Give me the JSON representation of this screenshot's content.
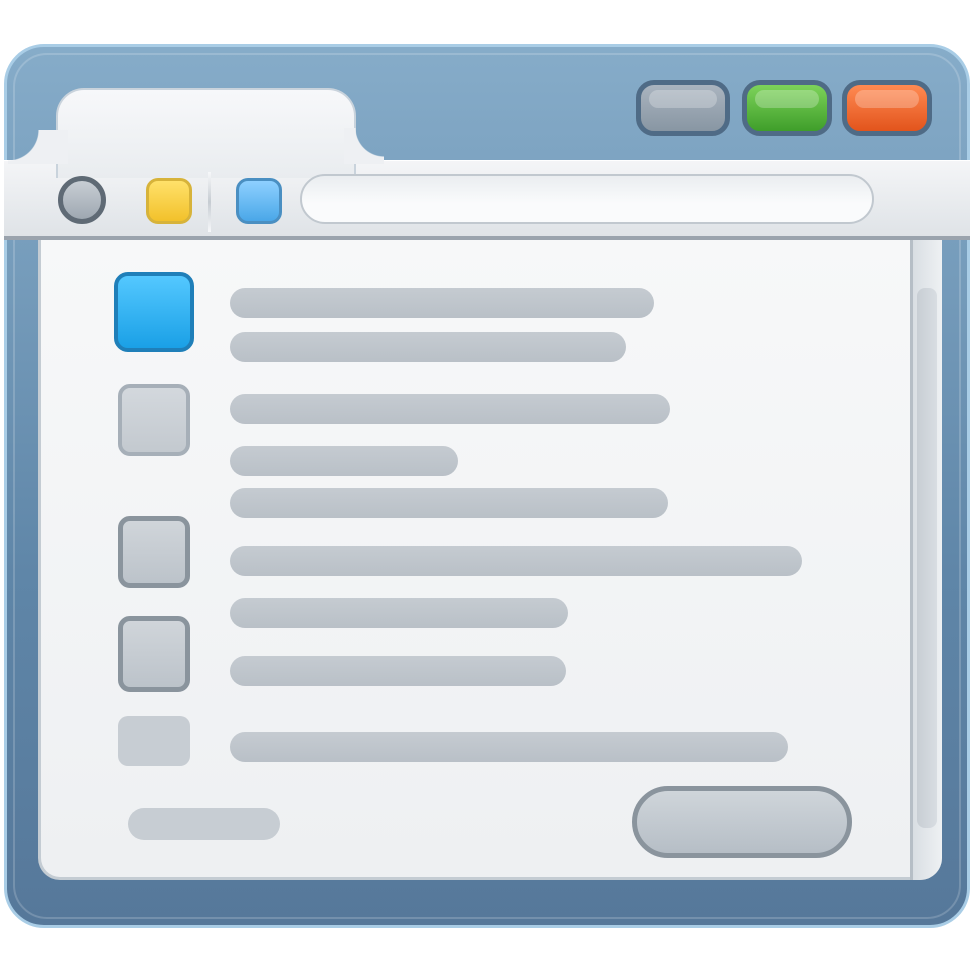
{
  "window": {
    "accent_color": "#5f86a8",
    "controls": [
      {
        "name": "minimize",
        "icon": "minimize-icon",
        "color": "#9aa5b0"
      },
      {
        "name": "maximize",
        "icon": "maximize-icon",
        "color": "#4fb83a"
      },
      {
        "name": "close",
        "icon": "close-icon",
        "color": "#f06526"
      }
    ]
  },
  "tab": {
    "label": ""
  },
  "toolbar": {
    "nav_buttons": [
      {
        "icon": "circle-icon",
        "color": "#a4aeb7"
      },
      {
        "icon": "yellow-square-icon",
        "color": "#f5c734"
      },
      {
        "icon": "blue-square-icon",
        "color": "#5fb6f0"
      }
    ],
    "address_value": ""
  },
  "list": {
    "items": [
      {
        "checkbox": "checked",
        "lines": [
          "",
          ""
        ]
      },
      {
        "checkbox": "unchecked",
        "lines": [
          "",
          "",
          ""
        ]
      },
      {
        "checkbox": "unchecked",
        "lines": [
          ""
        ]
      },
      {
        "checkbox": "unchecked",
        "lines": [
          "",
          ""
        ]
      },
      {
        "checkbox": "unchecked",
        "lines": [
          ""
        ]
      }
    ]
  },
  "footer": {
    "label": "",
    "action_label": ""
  }
}
